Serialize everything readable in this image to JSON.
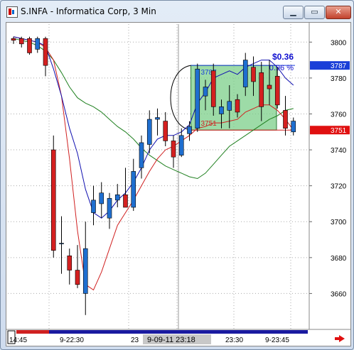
{
  "window": {
    "title": "S.INFA - Informatica Corp, 3 Min",
    "min_symbol": "▁",
    "max_symbol": "▭",
    "close_symbol": "✕"
  },
  "colors": {
    "up": "#1f6fd0",
    "down": "#d42020",
    "ma_fast": "#1010b0",
    "ma_mid": "#d02020",
    "ma_slow": "#208020",
    "box_fill": "#7ccf8a",
    "badge_blue": "#1a3fd8",
    "badge_red": "#e01010"
  },
  "price_axis": {
    "ticks": [
      "3800",
      "3780",
      "3760",
      "3740",
      "3720",
      "3700",
      "3680",
      "3660"
    ],
    "current_high_badge": "3787",
    "current_low_badge": "3751"
  },
  "time_axis": {
    "labels": [
      "14:45",
      "9-22:30",
      "23",
      "9-09-11  23:18",
      "23:30",
      "9-23:45"
    ],
    "cursor_label": "9-09-11  23:18"
  },
  "measure_box": {
    "high_label": "3787",
    "low_label": "3751",
    "gain": "$0.36",
    "gain_pct": "0.96 %"
  },
  "chart_data": {
    "type": "candlestick",
    "title": "S.INFA - Informatica Corp, 3 Min",
    "ylim": [
      3640,
      3810
    ],
    "candles": [
      {
        "o": 3802,
        "h": 3803,
        "l": 3799,
        "c": 3801
      },
      {
        "o": 3802,
        "h": 3803,
        "l": 3797,
        "c": 3799
      },
      {
        "o": 3802,
        "h": 3803,
        "l": 3793,
        "c": 3794
      },
      {
        "o": 3796,
        "h": 3803,
        "l": 3794,
        "c": 3802
      },
      {
        "o": 3802,
        "h": 3803,
        "l": 3781,
        "c": 3787
      },
      {
        "o": 3740,
        "h": 3748,
        "l": 3680,
        "c": 3684
      },
      {
        "o": 3688,
        "h": 3703,
        "l": 3671,
        "c": 3688
      },
      {
        "o": 3681,
        "h": 3685,
        "l": 3665,
        "c": 3673
      },
      {
        "o": 3673,
        "h": 3687,
        "l": 3663,
        "c": 3665
      },
      {
        "o": 3660,
        "h": 3700,
        "l": 3648,
        "c": 3685
      },
      {
        "o": 3705,
        "h": 3720,
        "l": 3698,
        "c": 3712
      },
      {
        "o": 3710,
        "h": 3722,
        "l": 3702,
        "c": 3716
      },
      {
        "o": 3702,
        "h": 3716,
        "l": 3696,
        "c": 3713
      },
      {
        "o": 3712,
        "h": 3721,
        "l": 3708,
        "c": 3715
      },
      {
        "o": 3715,
        "h": 3730,
        "l": 3708,
        "c": 3708
      },
      {
        "o": 3708,
        "h": 3735,
        "l": 3706,
        "c": 3728
      },
      {
        "o": 3730,
        "h": 3748,
        "l": 3724,
        "c": 3744
      },
      {
        "o": 3743,
        "h": 3762,
        "l": 3738,
        "c": 3757
      },
      {
        "o": 3757,
        "h": 3763,
        "l": 3748,
        "c": 3758
      },
      {
        "o": 3756,
        "h": 3761,
        "l": 3742,
        "c": 3745
      },
      {
        "o": 3745,
        "h": 3748,
        "l": 3730,
        "c": 3736
      },
      {
        "o": 3737,
        "h": 3752,
        "l": 3736,
        "c": 3748
      },
      {
        "o": 3749,
        "h": 3756,
        "l": 3745,
        "c": 3753
      },
      {
        "o": 3752,
        "h": 3788,
        "l": 3750,
        "c": 3785
      },
      {
        "o": 3770,
        "h": 3779,
        "l": 3762,
        "c": 3775
      },
      {
        "o": 3784,
        "h": 3788,
        "l": 3759,
        "c": 3764
      },
      {
        "o": 3760,
        "h": 3768,
        "l": 3752,
        "c": 3764
      },
      {
        "o": 3762,
        "h": 3776,
        "l": 3752,
        "c": 3767
      },
      {
        "o": 3768,
        "h": 3771,
        "l": 3758,
        "c": 3761
      },
      {
        "o": 3775,
        "h": 3794,
        "l": 3770,
        "c": 3790
      },
      {
        "o": 3786,
        "h": 3792,
        "l": 3770,
        "c": 3778
      },
      {
        "o": 3783,
        "h": 3789,
        "l": 3756,
        "c": 3764
      },
      {
        "o": 3776,
        "h": 3790,
        "l": 3765,
        "c": 3774
      },
      {
        "o": 3781,
        "h": 3786,
        "l": 3763,
        "c": 3765
      },
      {
        "o": 3762,
        "h": 3770,
        "l": 3748,
        "c": 3752
      },
      {
        "o": 3750,
        "h": 3758,
        "l": 3748,
        "c": 3756
      }
    ],
    "ma_fast": [
      3803,
      3802,
      3801,
      3800,
      3798,
      3785,
      3770,
      3752,
      3738,
      3718,
      3705,
      3702,
      3706,
      3712,
      3716,
      3722,
      3730,
      3740,
      3746,
      3748,
      3748,
      3750,
      3754,
      3766,
      3772,
      3780,
      3782,
      3784,
      3782,
      3786,
      3788,
      3790,
      3790,
      3786,
      3780,
      3776
    ],
    "ma_mid": [
      3803,
      3802,
      3801,
      3800,
      3797,
      3790,
      3770,
      3735,
      3695,
      3665,
      3662,
      3672,
      3685,
      3698,
      3705,
      3712,
      3720,
      3728,
      3735,
      3740,
      3742,
      3745,
      3748,
      3752,
      3753,
      3755,
      3755,
      3756,
      3757,
      3761,
      3763,
      3765,
      3765,
      3762,
      3757,
      3751
    ],
    "ma_slow": [
      3802,
      3801,
      3800,
      3798,
      3795,
      3790,
      3783,
      3775,
      3769,
      3766,
      3764,
      3761,
      3757,
      3753,
      3750,
      3746,
      3741,
      3737,
      3734,
      3731,
      3729,
      3727,
      3725,
      3724,
      3727,
      3732,
      3737,
      3742,
      3745,
      3748,
      3751,
      3754,
      3757,
      3759,
      3762,
      3763
    ],
    "box": {
      "start_index": 22,
      "end_index": 32,
      "high": 3787,
      "low": 3751
    }
  }
}
